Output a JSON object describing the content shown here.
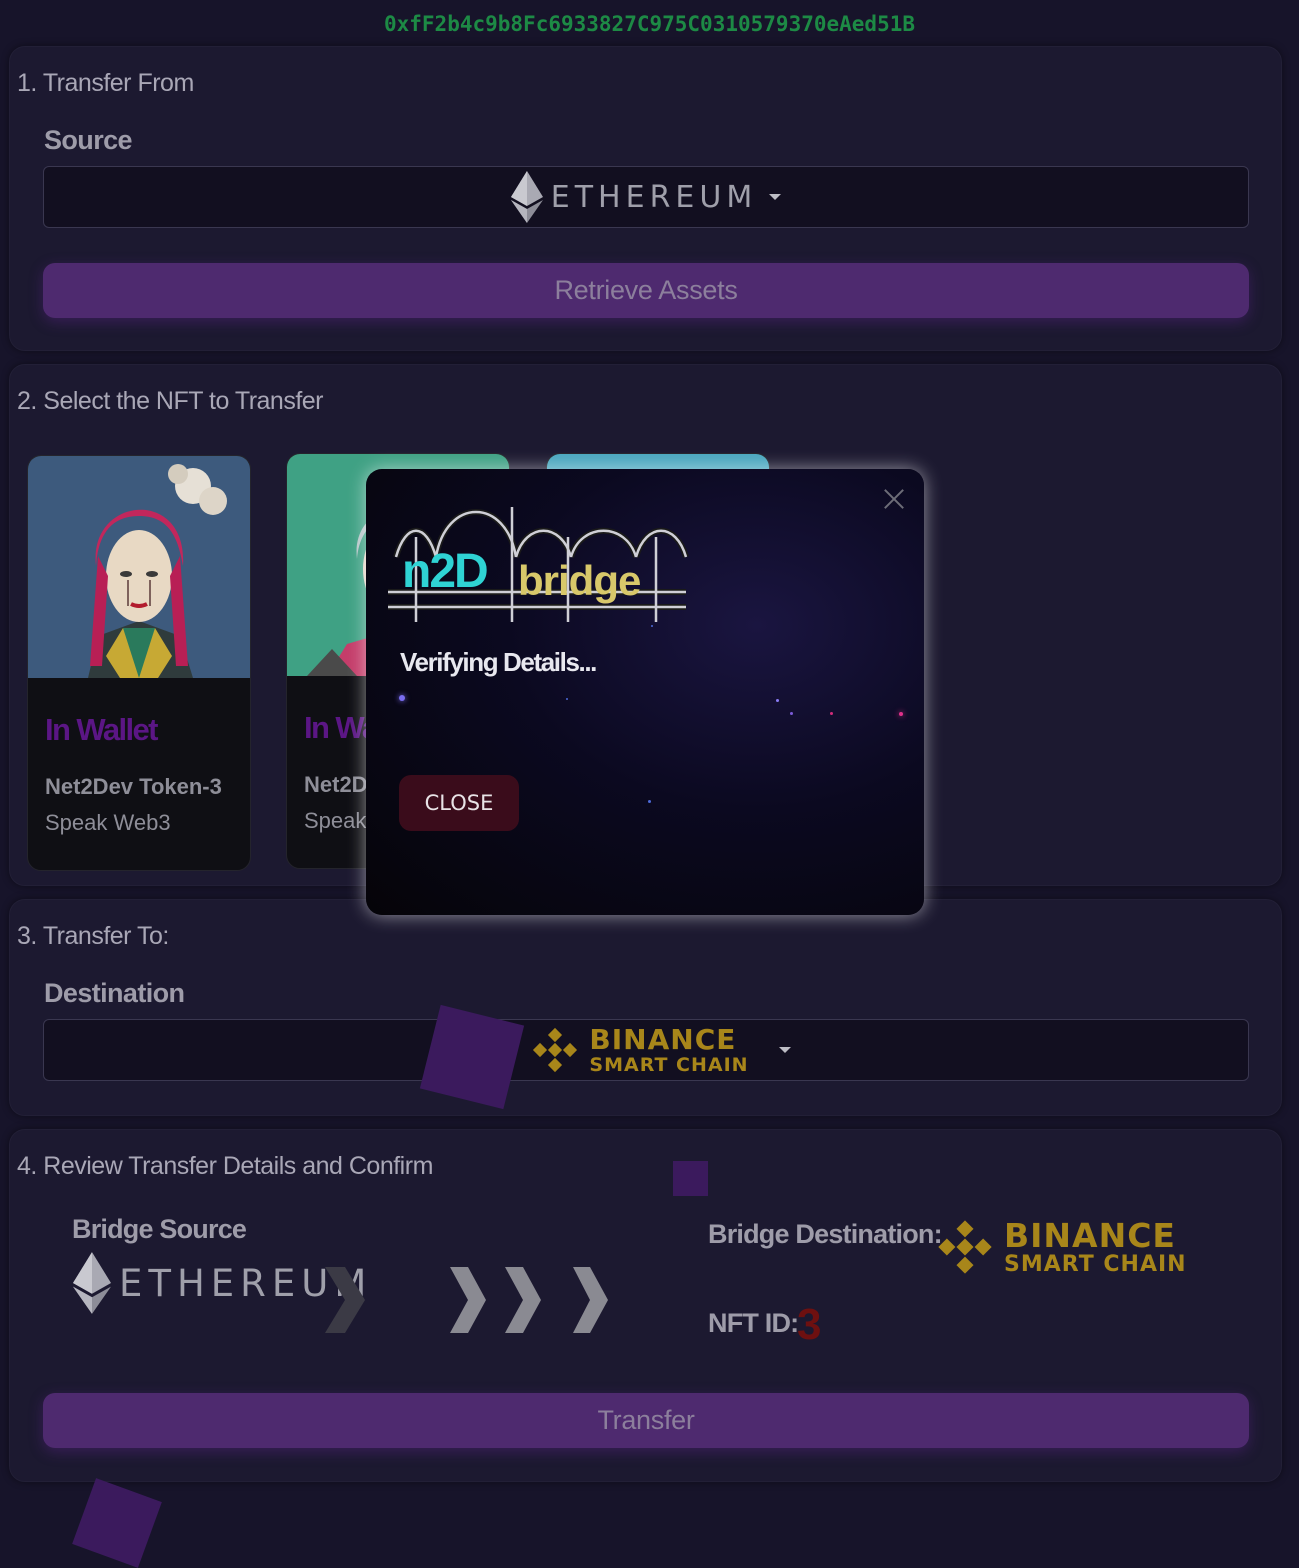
{
  "wallet_address": "0xfF2b4c9b8Fc6933827C975C0310579370eAed51B",
  "step1": {
    "title": "1. Transfer From",
    "field_label": "Source",
    "selected_chain": "ETHEREUM",
    "button_label": "Retrieve Assets"
  },
  "step2": {
    "title": "2. Select the NFT to Transfer",
    "cards": [
      {
        "status": "In Wallet",
        "name": "Net2Dev Token-3",
        "description": "Speak Web3"
      },
      {
        "status": "In Wa",
        "name": "Net2D",
        "description": "Speak W"
      }
    ]
  },
  "step3": {
    "title": "3. Transfer To:",
    "field_label": "Destination",
    "selected_chain_line1": "BINANCE",
    "selected_chain_line2": "SMART CHAIN"
  },
  "step4": {
    "title": "4. Review Transfer Details and Confirm",
    "source_label": "Bridge Source",
    "source_chain": "ETHEREUM",
    "destination_label": "Bridge Destination:",
    "destination_chain_line1": "BINANCE",
    "destination_chain_line2": "SMART CHAIN",
    "nft_id_label": "NFT ID:",
    "nft_id_value": "3",
    "button_label": "Transfer"
  },
  "modal": {
    "logo_part1": "n2D",
    "logo_part2": "bridge",
    "status_text": "Verifying Details...",
    "close_button": "CLOSE"
  },
  "colors": {
    "background": "#17142a",
    "accent_purple": "#4e2a6f",
    "address_green": "#1d8a45",
    "binance_gold": "#a8861a",
    "nft_id_red": "#6e1010"
  }
}
